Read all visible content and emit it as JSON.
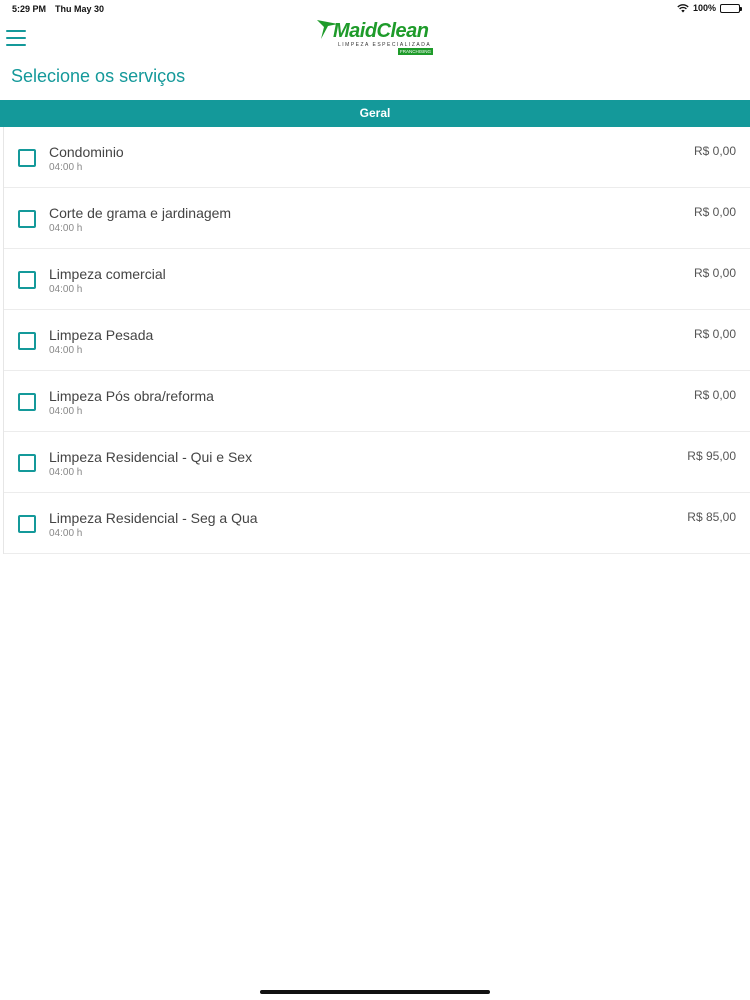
{
  "status_bar": {
    "time": "5:29 PM",
    "date": "Thu May 30",
    "battery_text": "100%",
    "battery_level": 1.0
  },
  "header": {
    "menu_icon": "hamburger-menu-icon",
    "logo": {
      "name": "MaidClean",
      "tagline": "LIMPEZA ESPECIALIZADA",
      "badge": "FRANCHISING"
    }
  },
  "page": {
    "title": "Selecione os serviços"
  },
  "section": {
    "title": "Geral"
  },
  "services": [
    {
      "name": "Condominio",
      "duration": "04:00 h",
      "price": "R$ 0,00"
    },
    {
      "name": "Corte de grama e jardinagem",
      "duration": "04:00 h",
      "price": "R$ 0,00"
    },
    {
      "name": "Limpeza comercial",
      "duration": "04:00 h",
      "price": "R$ 0,00"
    },
    {
      "name": "Limpeza Pesada",
      "duration": "04:00 h",
      "price": "R$ 0,00"
    },
    {
      "name": "Limpeza Pós obra/reforma",
      "duration": "04:00 h",
      "price": "R$ 0,00"
    },
    {
      "name": "Limpeza Residencial - Qui e Sex",
      "duration": "04:00 h",
      "price": "R$ 95,00"
    },
    {
      "name": "Limpeza Residencial - Seg a Qua",
      "duration": "04:00 h",
      "price": "R$ 85,00"
    }
  ],
  "colors": {
    "accent": "#14999a",
    "logo_green": "#1e9b2a"
  }
}
